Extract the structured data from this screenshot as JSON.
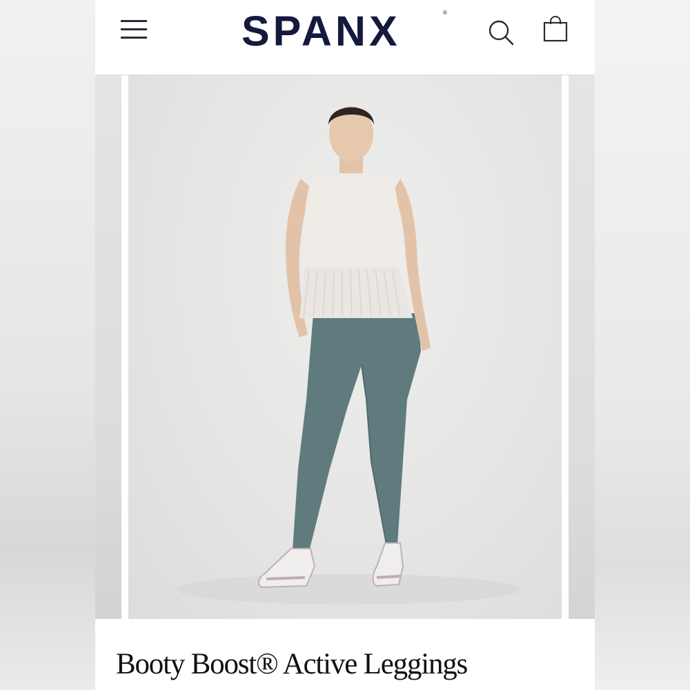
{
  "header": {
    "brand": "SPANX",
    "brand_mark": "®",
    "menu_icon": "hamburger-menu-icon",
    "search_icon": "search-icon",
    "bag_icon": "shopping-bag-icon"
  },
  "gallery": {
    "main_image": "product-photo-model-wearing-leggings",
    "colors": {
      "leggings": "#5f7b7e",
      "top": "#efebe6",
      "background": "#e6e6e5"
    }
  },
  "product": {
    "title": "Booty Boost® Active Leggings"
  },
  "colors": {
    "brand_navy": "#141a3c"
  }
}
